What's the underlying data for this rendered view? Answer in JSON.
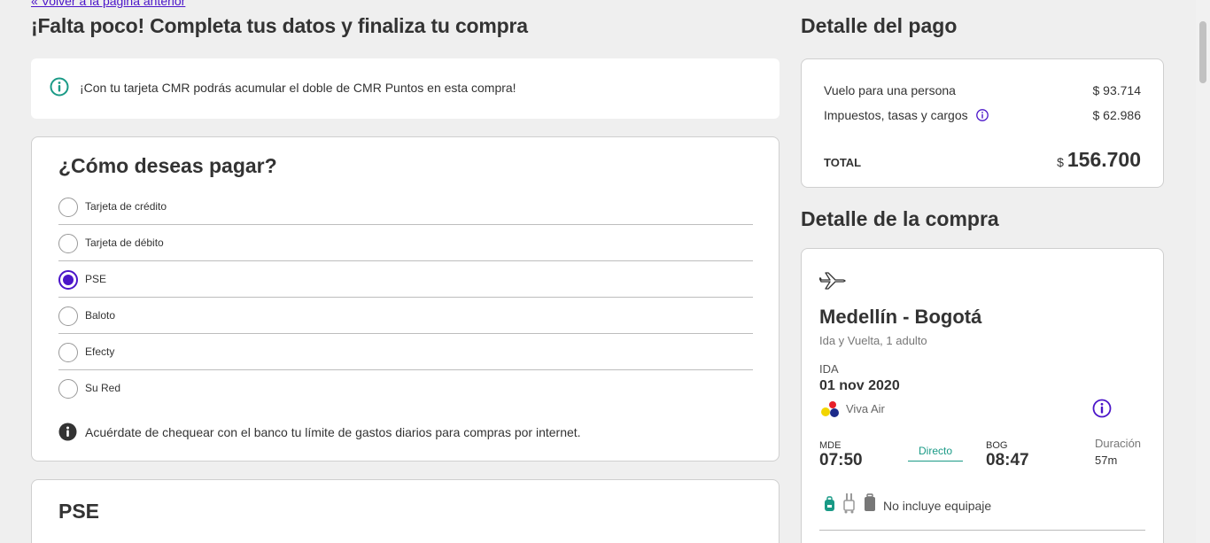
{
  "header": {
    "back_link": "« Volver a la página anterior",
    "title": "¡Falta poco! Completa tus datos y finaliza tu compra"
  },
  "promo": {
    "text": "¡Con tu tarjeta CMR podrás acumular el doble de CMR Puntos en esta compra!"
  },
  "payment": {
    "title": "¿Cómo deseas pagar?",
    "options": [
      {
        "label": "Tarjeta de crédito",
        "selected": false
      },
      {
        "label": "Tarjeta de débito",
        "selected": false
      },
      {
        "label": "PSE",
        "selected": true
      },
      {
        "label": "Baloto",
        "selected": false
      },
      {
        "label": "Efecty",
        "selected": false
      },
      {
        "label": "Su Red",
        "selected": false
      }
    ],
    "reminder": "Acuérdate de chequear con el banco tu límite de gastos diarios para compras por internet."
  },
  "pse": {
    "title": "PSE"
  },
  "payment_detail": {
    "title": "Detalle del pago",
    "rows": [
      {
        "label": "Vuelo para una persona",
        "amount": "$ 93.714"
      },
      {
        "label": "Impuestos, tasas y cargos",
        "amount": "$ 62.986"
      }
    ],
    "total_label": "TOTAL",
    "total_currency": "$",
    "total_amount": "156.700"
  },
  "purchase_detail": {
    "title": "Detalle de la compra",
    "route": "Medellín - Bogotá",
    "trip_type": "Ida y Vuelta, 1 adulto",
    "leg_label": "IDA",
    "date": "01 nov 2020",
    "airline": "Viva Air",
    "origin_code": "MDE",
    "origin_time": "07:50",
    "stops": "Directo",
    "dest_code": "BOG",
    "dest_time": "08:47",
    "duration_label": "Duración",
    "duration_value": "57m",
    "baggage": "No incluye equipaje"
  },
  "colors": {
    "accent": "#4b15c9",
    "teal": "#1a9a86",
    "background": "#efefef"
  }
}
